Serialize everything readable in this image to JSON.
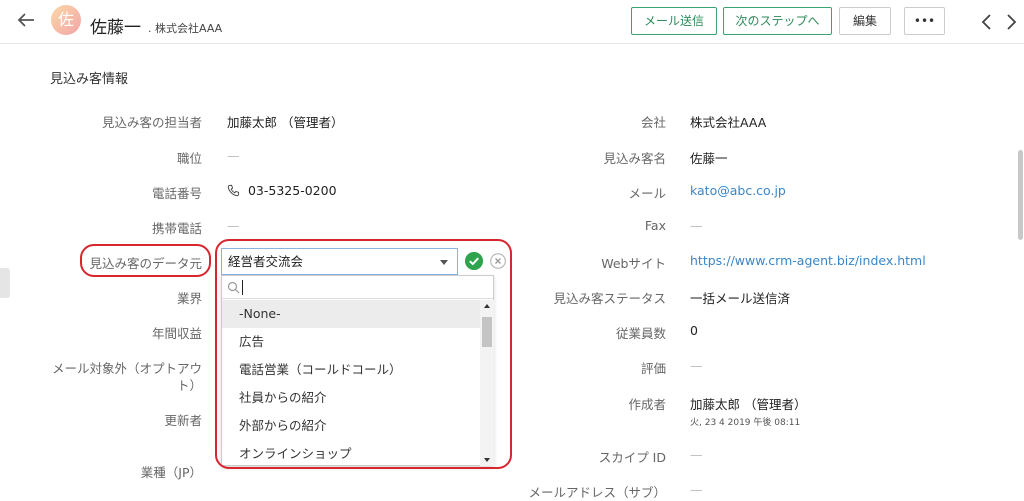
{
  "header": {
    "avatar_char": "佐",
    "name": "佐藤一",
    "company": ". 株式会社AAA",
    "buttons": {
      "send_mail": "メール送信",
      "next_step": "次のステップへ",
      "edit": "編集",
      "more": "•••"
    }
  },
  "section_title": "見込み客情報",
  "left_fields": [
    {
      "label": "見込み客の担当者",
      "value": "加藤太郎 （管理者）"
    },
    {
      "label": "職位",
      "value": "—"
    },
    {
      "label": "電話番号",
      "value": "03-5325-0200"
    },
    {
      "label": "携帯電話",
      "value": "—"
    },
    {
      "label": "見込み客のデータ元"
    },
    {
      "label": "業界"
    },
    {
      "label": "年間収益"
    },
    {
      "label": "メール対象外（オプトアウ",
      "label_line2": "ト）"
    },
    {
      "label": "更新者"
    },
    {
      "label": "業種（JP）"
    }
  ],
  "right_fields": [
    {
      "label": "会社",
      "value": "株式会社AAA"
    },
    {
      "label": "見込み客名",
      "value": "佐藤一"
    },
    {
      "label": "メール",
      "value": "kato@abc.co.jp"
    },
    {
      "label": "Fax",
      "value": "—"
    },
    {
      "label": "Webサイト",
      "value": "https://www.crm-agent.biz/index.html"
    },
    {
      "label": "見込み客ステータス",
      "value": "一括メール送信済"
    },
    {
      "label": "従業員数",
      "value": "0"
    },
    {
      "label": "評価",
      "value": "—"
    },
    {
      "label": "作成者",
      "value": "加藤太郎 （管理者）",
      "sub": "火, 23 4 2019 午後 08:11"
    },
    {
      "label": "スカイプ ID",
      "value": "—"
    },
    {
      "label": "メールアドレス（サブ）",
      "value": "—"
    }
  ],
  "lead_source_select": {
    "selected": "経営者交流会",
    "search_value": "",
    "options": [
      "-None-",
      "広告",
      "電話営業（コールドコール）",
      "社員からの紹介",
      "外部からの紹介",
      "オンラインショップ"
    ]
  },
  "colors": {
    "highlight": "#d8262e",
    "confirm": "#2fa44f",
    "link": "#3a86c9",
    "primary_btn_border": "#3aa371"
  }
}
